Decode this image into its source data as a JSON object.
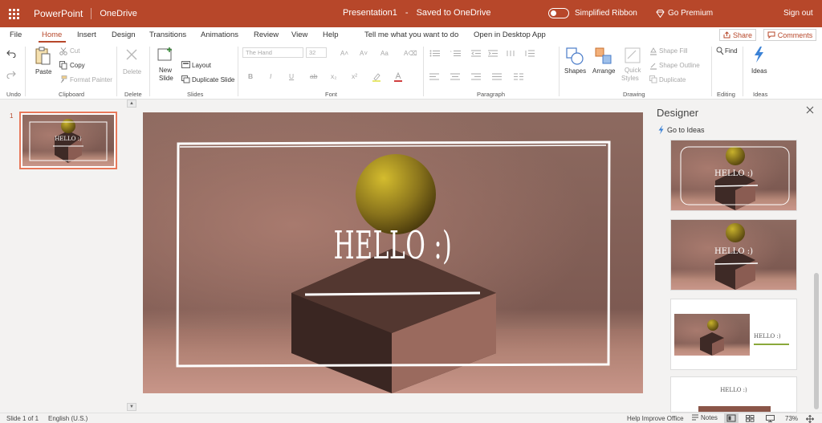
{
  "titlebar": {
    "app_name": "PowerPoint",
    "location": "OneDrive",
    "doc_title": "Presentation1",
    "separator": "-",
    "save_status": "Saved to OneDrive",
    "simplified_ribbon": "Simplified Ribbon",
    "go_premium": "Go Premium",
    "sign_out": "Sign out",
    "accent_color": "#b7472a"
  },
  "tabs": [
    {
      "label": "File"
    },
    {
      "label": "Home"
    },
    {
      "label": "Insert"
    },
    {
      "label": "Design"
    },
    {
      "label": "Transitions"
    },
    {
      "label": "Animations"
    },
    {
      "label": "Review"
    },
    {
      "label": "View"
    },
    {
      "label": "Help"
    },
    {
      "label": "Tell me what you want to do"
    },
    {
      "label": "Open in Desktop App"
    }
  ],
  "active_tab": "Home",
  "share_label": "Share",
  "comments_label": "Comments",
  "ribbon": {
    "undo_group": "Undo",
    "paste": "Paste",
    "cut": "Cut",
    "copy": "Copy",
    "format_painter": "Format Painter",
    "clipboard_group": "Clipboard",
    "delete": "Delete",
    "delete_group": "Delete",
    "new_slide_1": "New",
    "new_slide_2": "Slide",
    "layout": "Layout",
    "duplicate_slide": "Duplicate Slide",
    "slides_group": "Slides",
    "font_name": "The Hand",
    "font_size": "32",
    "font_group": "Font",
    "paragraph_group": "Paragraph",
    "shapes": "Shapes",
    "arrange": "Arrange",
    "quick_styles_1": "Quick",
    "quick_styles_2": "Styles",
    "shape_fill": "Shape Fill",
    "shape_outline": "Shape Outline",
    "duplicate": "Duplicate",
    "drawing_group": "Drawing",
    "find": "Find",
    "editing_group": "Editing",
    "ideas": "Ideas",
    "ideas_group": "Ideas"
  },
  "thumbnails": [
    {
      "number": "1",
      "title": "HELLO :)"
    }
  ],
  "slide": {
    "title": "HELLO :)"
  },
  "designer": {
    "title": "Designer",
    "go_to_ideas": "Go to Ideas",
    "ideas": [
      {
        "text": "HELLO :)"
      },
      {
        "text": "HELLO :)"
      },
      {
        "text": "HELLO :)"
      },
      {
        "text": "HELLO :)"
      }
    ]
  },
  "status": {
    "slide_count": "Slide 1 of 1",
    "language": "English (U.S.)",
    "help_improve": "Help Improve Office",
    "notes": "Notes",
    "zoom": "73%"
  }
}
